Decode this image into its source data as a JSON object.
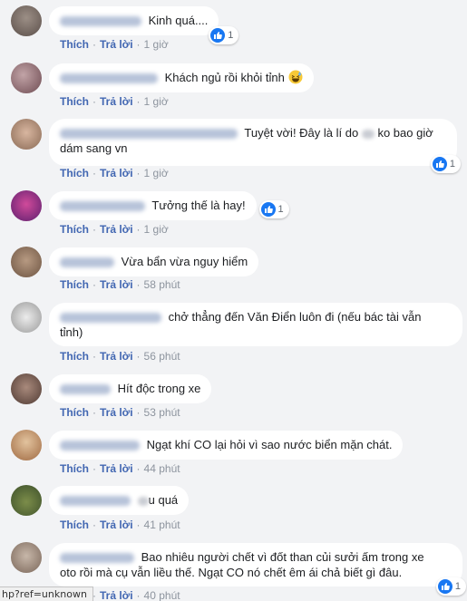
{
  "actions": {
    "like": "Thích",
    "reply": "Trả lời",
    "separator": "·"
  },
  "comments": [
    {
      "text": "Kinh quá....",
      "time": "1 giờ",
      "likes": "1"
    },
    {
      "text": "Khách ngủ rồi khỏi tỉnh",
      "time": "1 giờ",
      "emoji": "laughing-sweat-emoji"
    },
    {
      "text_before": "Tuyệt vời! Đây là lí do",
      "text_after": "ko bao giờ dám sang vn",
      "time": "1 giờ",
      "likes": "1"
    },
    {
      "text": "Tưởng thế là hay!",
      "time": "1 giờ",
      "likes": "1"
    },
    {
      "text": "Vừa bẩn vừa nguy hiểm",
      "time": "58 phút"
    },
    {
      "text_line1": "chở thẳng đến Văn Điển luôn đi (nếu bác tài vẫn",
      "text_line2": "tỉnh)",
      "time": "56 phút"
    },
    {
      "text": "Hít độc trong xe",
      "time": "53 phút"
    },
    {
      "text": "Ngạt khí CO lại hỏi vì sao nước biển mặn chát.",
      "time": "44 phút"
    },
    {
      "text": "u quá",
      "time": "41 phút"
    },
    {
      "text_line1": "Bao nhiêu người chết vì đốt than củi sưởi ấm trong xe",
      "text_line2": "oto rồi mà cụ vẫn liều thế. Ngạt CO nó chết êm ái chả biết gì đâu.",
      "time": "40 phút",
      "likes": "1"
    }
  ],
  "statusbar": {
    "url": "hp?ref=unknown"
  },
  "colors": {
    "link": "#4267b2",
    "like_blue": "#1877f2",
    "bubble": "#ffffff",
    "background": "#f2f3f5"
  }
}
